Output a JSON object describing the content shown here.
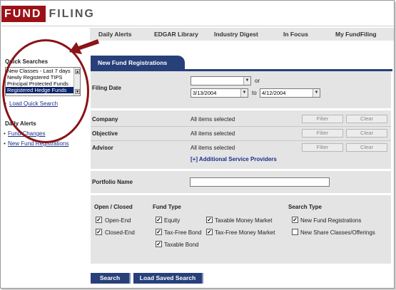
{
  "brand": {
    "logo_box": "FUND",
    "logo_text": "FILING"
  },
  "nav": [
    "Daily Alerts",
    "EDGAR Library",
    "Industry Digest",
    "In Focus",
    "My FundFiling"
  ],
  "sidebar": {
    "quick_searches_title": "Quick Searches",
    "quick_searches": [
      "New Classes - Last 7 days",
      "Newly Registered TIPS",
      "Principal Protected Funds",
      "Registered Hedge Funds"
    ],
    "selected_quick_search": "Registered Hedge Funds",
    "load_quick_search": "Load Quick Search",
    "daily_alerts_title": "Daily Alerts",
    "daily_alerts": [
      "Fund Changes",
      "New Fund Registrations"
    ]
  },
  "main": {
    "tab_label": "New Fund Registrations",
    "filing_date": {
      "label": "Filing Date",
      "preset_value": "",
      "or_text": "or",
      "from": "3/13/2004",
      "to_text": "to",
      "to": "4/12/2004"
    },
    "filters": [
      {
        "label": "Company",
        "value": "All items selected",
        "filter_btn": "Filter",
        "clear_btn": "Clear"
      },
      {
        "label": "Objective",
        "value": "All items selected",
        "filter_btn": "Filter",
        "clear_btn": "Clear"
      },
      {
        "label": "Advisor",
        "value": "All items selected",
        "filter_btn": "Filter",
        "clear_btn": "Clear"
      }
    ],
    "additional_providers": "[+] Additional Service Providers",
    "portfolio_label": "Portfolio Name",
    "portfolio_value": "",
    "groups": {
      "open_closed": {
        "title": "Open / Closed",
        "items": [
          {
            "label": "Open-End",
            "checked": true
          },
          {
            "label": "Closed-End",
            "checked": true
          }
        ]
      },
      "fund_type_a": {
        "title": "Fund Type",
        "items": [
          {
            "label": "Equity",
            "checked": true
          },
          {
            "label": "Tax-Free Bond",
            "checked": true
          },
          {
            "label": "Taxable Bond",
            "checked": true
          }
        ]
      },
      "fund_type_b": {
        "items": [
          {
            "label": "Taxable Money Market",
            "checked": true
          },
          {
            "label": "Tax-Free Money Market",
            "checked": true
          }
        ]
      },
      "search_type": {
        "title": "Search Type",
        "items": [
          {
            "label": "New Fund Registrations",
            "checked": true
          },
          {
            "label": "New Share Classes/Offerings",
            "checked": false
          }
        ]
      }
    },
    "search_btn": "Search",
    "load_saved_btn": "Load Saved Search"
  },
  "colors": {
    "brand_red": "#9c1118",
    "navy": "#27407a",
    "panel_gray": "#e4e4e4",
    "callout": "#8a1418"
  }
}
